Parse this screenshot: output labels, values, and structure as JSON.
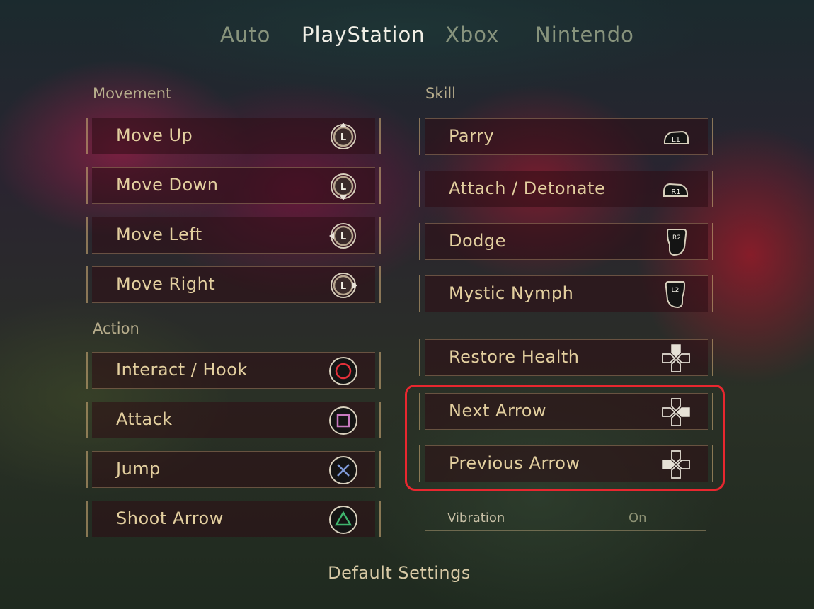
{
  "tabs": [
    {
      "label": "Auto",
      "active": false
    },
    {
      "label": "PlayStation",
      "active": true
    },
    {
      "label": "Xbox",
      "active": false
    },
    {
      "label": "Nintendo",
      "active": false
    }
  ],
  "movement": {
    "title": "Movement",
    "items": [
      {
        "label": "Move Up",
        "icon": "left-stick-up-icon"
      },
      {
        "label": "Move Down",
        "icon": "left-stick-down-icon"
      },
      {
        "label": "Move Left",
        "icon": "left-stick-left-icon"
      },
      {
        "label": "Move Right",
        "icon": "left-stick-right-icon"
      }
    ],
    "stick_letter": "L"
  },
  "action": {
    "title": "Action",
    "items": [
      {
        "label": "Interact / Hook",
        "icon": "circle-button-icon"
      },
      {
        "label": "Attack",
        "icon": "square-button-icon"
      },
      {
        "label": "Jump",
        "icon": "cross-button-icon"
      },
      {
        "label": "Shoot Arrow",
        "icon": "triangle-button-icon"
      }
    ]
  },
  "skill": {
    "title": "Skill",
    "items": [
      {
        "label": "Parry",
        "icon": "l1-button-icon",
        "button_text": "L1"
      },
      {
        "label": "Attach / Detonate",
        "icon": "r1-button-icon",
        "button_text": "R1"
      },
      {
        "label": "Dodge",
        "icon": "r2-trigger-icon",
        "button_text": "R2"
      },
      {
        "label": "Mystic Nymph",
        "icon": "l2-trigger-icon",
        "button_text": "L2"
      }
    ]
  },
  "dpad": {
    "items": [
      {
        "label": "Restore Health",
        "icon": "dpad-up-icon"
      },
      {
        "label": "Next Arrow",
        "icon": "dpad-right-icon"
      },
      {
        "label": "Previous Arrow",
        "icon": "dpad-left-icon"
      }
    ]
  },
  "vibration": {
    "label": "Vibration",
    "value": "On"
  },
  "default_button": "Default Settings",
  "colors": {
    "highlight": "#e8272f",
    "label_text": "#e3cf9f",
    "circle_button": "#e0303a",
    "square_button": "#c879c0",
    "cross_button": "#7e9ad8",
    "triangle_button": "#3fb56e"
  }
}
